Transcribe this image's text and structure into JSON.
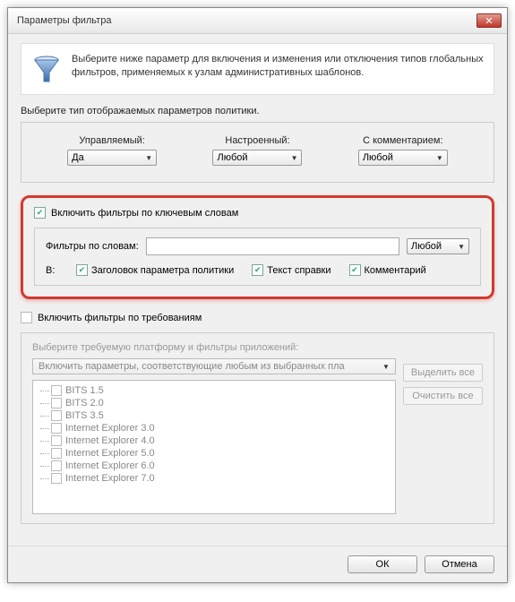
{
  "title": "Параметры фильтра",
  "header": "Выберите ниже параметр для включения и изменения или отключения типов глобальных фильтров, применяемых к узлам административных шаблонов.",
  "policy": {
    "prompt": "Выберите тип отображаемых параметров политики.",
    "managed_label": "Управляемый:",
    "managed_value": "Да",
    "configured_label": "Настроенный:",
    "configured_value": "Любой",
    "commented_label": "С комментарием:",
    "commented_value": "Любой"
  },
  "keywords": {
    "enable": "Включить фильтры по ключевым словам",
    "filter_label": "Фильтры по словам:",
    "filter_value": "",
    "match_value": "Любой",
    "within_label": "В:",
    "title_chk": "Заголовок параметра политики",
    "help_chk": "Текст справки",
    "comment_chk": "Комментарий"
  },
  "requirements": {
    "enable": "Включить фильтры по требованиям",
    "platform_label": "Выберите требуемую платформу и фильтры приложений:",
    "dropdown": "Включить параметры, соответствующие любым из выбранных пла",
    "items": [
      "BITS 1.5",
      "BITS 2.0",
      "BITS 3.5",
      "Internet Explorer 3.0",
      "Internet Explorer 4.0",
      "Internet Explorer 5.0",
      "Internet Explorer 6.0",
      "Internet Explorer 7.0"
    ],
    "select_all": "Выделить все",
    "clear_all": "Очистить все"
  },
  "footer": {
    "ok": "ОК",
    "cancel": "Отмена"
  }
}
